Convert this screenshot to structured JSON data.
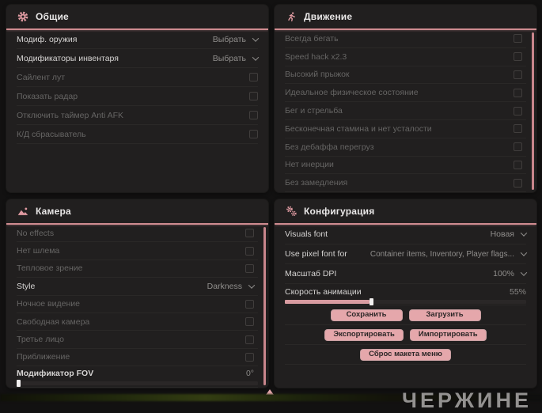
{
  "colors": {
    "accent_pink": "#cf8b90",
    "icon_pink": "#df9aa1",
    "button_pink": "#e5a7ab",
    "panel_bg": "#211f1f",
    "page_bg": "#121111",
    "bright_text": "#d6d4d3",
    "dim_text": "#666564"
  },
  "panels": {
    "general": {
      "title": "Общие",
      "icon": "gear-icon",
      "rows": [
        {
          "label": "Модиф. оружия",
          "type": "dropdown",
          "value": "Выбрать"
        },
        {
          "label": "Модификаторы инвентаря",
          "type": "dropdown",
          "value": "Выбрать"
        },
        {
          "label": "Сайлент лут",
          "type": "checkbox",
          "checked": false
        },
        {
          "label": "Показать радар",
          "type": "checkbox",
          "checked": false
        },
        {
          "label": "Отключить таймер Anti AFK",
          "type": "checkbox",
          "checked": false
        },
        {
          "label": "К/Д сбрасыватель",
          "type": "checkbox",
          "checked": false
        }
      ]
    },
    "movement": {
      "title": "Движение",
      "icon": "runner-icon",
      "rows": [
        {
          "label": "Всегда бегать",
          "type": "checkbox",
          "checked": false
        },
        {
          "label": "Speed hack x2.3",
          "type": "checkbox",
          "checked": false
        },
        {
          "label": "Высокий прыжок",
          "type": "checkbox",
          "checked": false
        },
        {
          "label": "Идеальное физическое состояние",
          "type": "checkbox",
          "checked": false
        },
        {
          "label": "Бег и стрельба",
          "type": "checkbox",
          "checked": false
        },
        {
          "label": "Бесконечная стамина и нет усталости",
          "type": "checkbox",
          "checked": false
        },
        {
          "label": "Без дебаффа перегруз",
          "type": "checkbox",
          "checked": false
        },
        {
          "label": "Нет инерции",
          "type": "checkbox",
          "checked": false
        },
        {
          "label": "Без замедления",
          "type": "checkbox",
          "checked": false
        }
      ]
    },
    "camera": {
      "title": "Камера",
      "icon": "image-icon",
      "rows": [
        {
          "label": "No effects",
          "type": "checkbox",
          "checked": false
        },
        {
          "label": "Нет шлема",
          "type": "checkbox",
          "checked": false
        },
        {
          "label": "Тепловое зрение",
          "type": "checkbox",
          "checked": false
        },
        {
          "label": "Style",
          "type": "dropdown",
          "value": "Darkness"
        },
        {
          "label": "Ночное видение",
          "type": "checkbox",
          "checked": false
        },
        {
          "label": "Свободная камера",
          "type": "checkbox",
          "checked": false
        },
        {
          "label": "Третье лицо",
          "type": "checkbox",
          "checked": false
        },
        {
          "label": "Приближение",
          "type": "checkbox",
          "checked": false
        },
        {
          "label": "Модификатор FOV",
          "type": "slider",
          "value": "0°",
          "slider_percent": 0
        }
      ]
    },
    "config": {
      "title": "Конфигурация",
      "icon": "gears-icon",
      "rows": [
        {
          "label": "Visuals font",
          "type": "dropdown",
          "value": "Новая"
        },
        {
          "label": "Use pixel font for",
          "type": "dropdown",
          "value": "Container items, Inventory, Player flags..."
        },
        {
          "label": "Масштаб DPI",
          "type": "dropdown",
          "value": "100%"
        },
        {
          "label": "Скорость анимации",
          "type": "slider",
          "value": "55%",
          "slider_percent": 35
        }
      ],
      "buttons": {
        "save": "Сохранить",
        "load": "Загрузить",
        "export": "Экспортировать",
        "import": "Импортировать",
        "reset": "Сброс макета меню"
      }
    }
  },
  "watermark": "ЧЕРЖИНЕ"
}
